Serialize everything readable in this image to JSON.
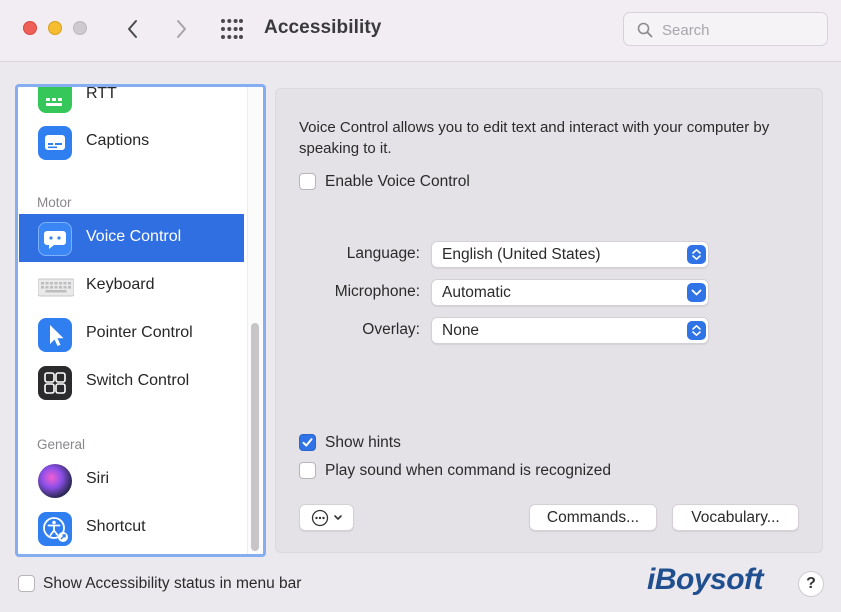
{
  "window": {
    "title": "Accessibility",
    "search_placeholder": "Search"
  },
  "sidebar": {
    "items_top": [
      {
        "label": "RTT",
        "icon": "rtt-icon"
      },
      {
        "label": "Captions",
        "icon": "captions-icon"
      }
    ],
    "section_motor": "Motor",
    "items_motor": [
      {
        "label": "Voice Control",
        "icon": "voice-control-icon",
        "selected": true
      },
      {
        "label": "Keyboard",
        "icon": "keyboard-icon"
      },
      {
        "label": "Pointer Control",
        "icon": "pointer-control-icon"
      },
      {
        "label": "Switch Control",
        "icon": "switch-control-icon"
      }
    ],
    "section_general": "General",
    "items_general": [
      {
        "label": "Siri",
        "icon": "siri-icon"
      },
      {
        "label": "Shortcut",
        "icon": "shortcut-icon"
      }
    ]
  },
  "panel": {
    "description": "Voice Control allows you to edit text and interact with your computer by speaking to it.",
    "enable_label": "Enable Voice Control",
    "enable_checked": false,
    "language_label": "Language:",
    "language_value": "English (United States)",
    "microphone_label": "Microphone:",
    "microphone_value": "Automatic",
    "overlay_label": "Overlay:",
    "overlay_value": "None",
    "show_hints_label": "Show hints",
    "show_hints_checked": true,
    "play_sound_label": "Play sound when command is recognized",
    "play_sound_checked": false,
    "commands_button": "Commands...",
    "vocabulary_button": "Vocabulary..."
  },
  "footer": {
    "status_label": "Show Accessibility status in menu bar",
    "status_checked": false,
    "brand": "iBoysoft",
    "help": "?"
  },
  "colors": {
    "accent": "#2f73e6",
    "selection": "#2f6fe2",
    "sidebar_focus_ring": "#85aef0"
  }
}
